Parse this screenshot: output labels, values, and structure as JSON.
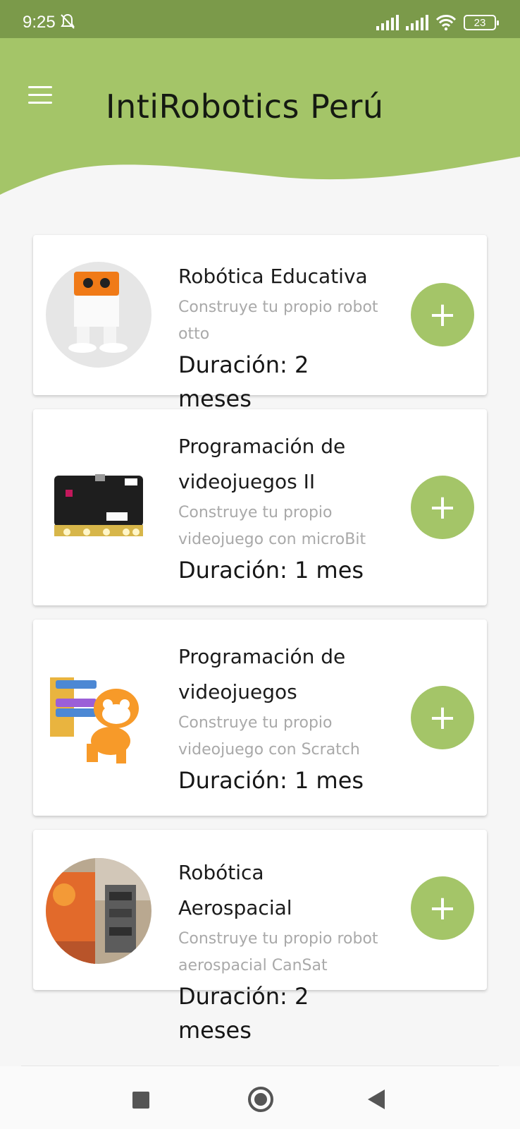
{
  "status_bar": {
    "time": "9:25",
    "battery": "23"
  },
  "header": {
    "title": "IntiRobotics Perú",
    "background_color": "#a4c568"
  },
  "courses": [
    {
      "title": "Robótica Educativa",
      "description": "Construye tu propio robot otto",
      "duration": "Duración: 2 meses",
      "image": "otto-robot"
    },
    {
      "title": "Programación de videojuegos II",
      "description": "Construye tu propio videojuego con microBit",
      "duration": "Duración: 1 mes",
      "image": "microbit-board"
    },
    {
      "title": "Programación de videojuegos",
      "description": "Construye tu propio videojuego con Scratch",
      "duration": "Duración: 1 mes",
      "image": "scratch-cat"
    },
    {
      "title": "Robótica Aerospacial",
      "description": "Construye tu propio robot aerospacial CanSat",
      "duration": "Duración: 2 meses",
      "image": "cansat-photo"
    }
  ],
  "add_button_label": "+",
  "accent_color": "#a4c568"
}
